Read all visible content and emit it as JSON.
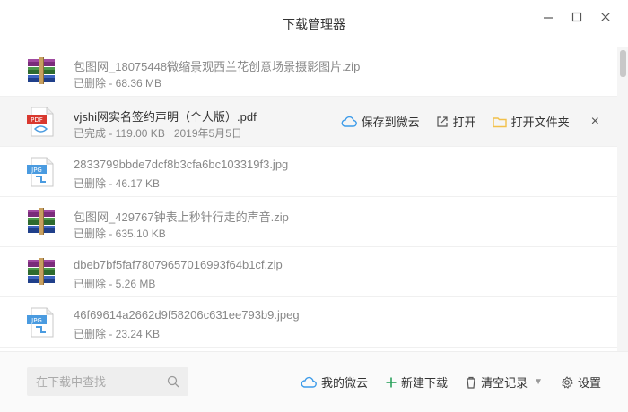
{
  "window": {
    "title": "下载管理器",
    "minimize_glyph": "—",
    "maximize_glyph": "□",
    "close_glyph": "✕"
  },
  "downloads": [
    {
      "icon": "zip-archive-icon",
      "name": "包图网_18075448微缩景观西兰花创意场景摄影图片.zip",
      "status": "已删除 - 68.36 MB",
      "date": ""
    },
    {
      "icon": "pdf-file-icon",
      "name": "vjshi网实名签约声明（个人版）.pdf",
      "status": "已完成 - 119.00 KB",
      "date": "2019年5月5日"
    },
    {
      "icon": "jpg-image-icon",
      "name": "2833799bbde7dcf8b3cfa6bc103319f3.jpg",
      "status": "已删除 - 46.17 KB",
      "date": ""
    },
    {
      "icon": "zip-archive-icon",
      "name": "包图网_429767钟表上秒针行走的声音.zip",
      "status": "已删除 - 635.10 KB",
      "date": ""
    },
    {
      "icon": "zip-archive-icon",
      "name": "dbeb7bf5faf78079657016993f64b1cf.zip",
      "status": "已删除 - 5.26 MB",
      "date": ""
    },
    {
      "icon": "jpg-image-icon",
      "name": "46f69614a2662d9f58206c631ee793b9.jpeg",
      "status": "已删除 - 23.24 KB",
      "date": ""
    }
  ],
  "selected_row_actions": {
    "save_to_cloud": "保存到微云",
    "open": "打开",
    "open_folder": "打开文件夹",
    "remove": "×"
  },
  "footer": {
    "search_placeholder": "在下载中查找",
    "my_cloud": "我的微云",
    "new_download": "新建下载",
    "clear_records": "清空记录",
    "settings": "设置"
  },
  "colors": {
    "cloud_icon": "#3d9be9",
    "new_download_plus": "#2aa15c",
    "folder_icon": "#f2c04a",
    "pdf_badge": "#d9382f",
    "jpg_badge": "#4a9be0"
  }
}
